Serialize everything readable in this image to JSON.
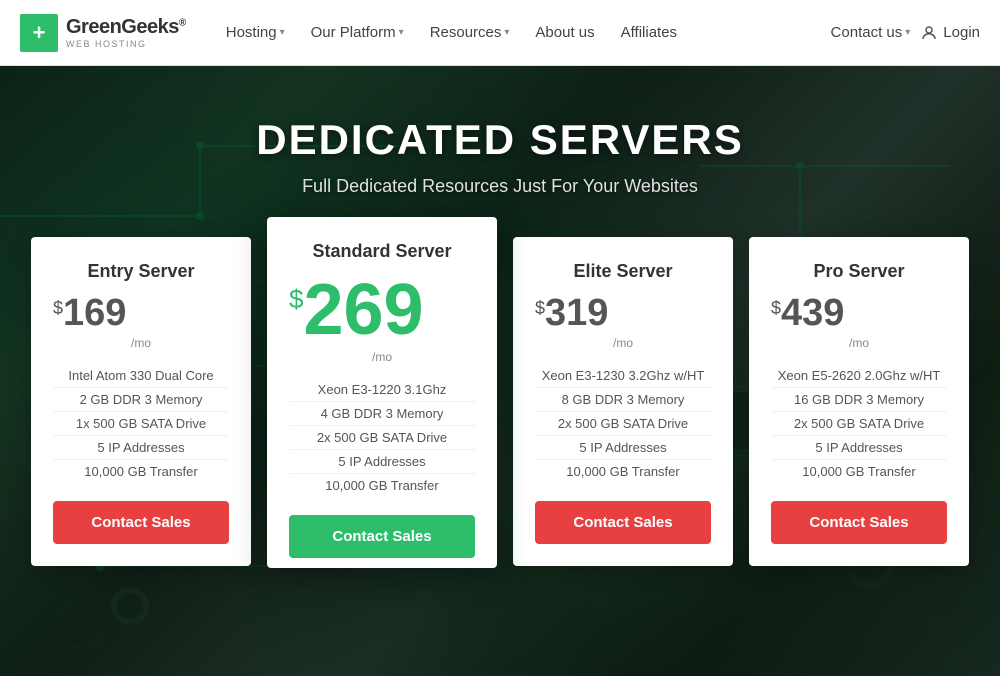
{
  "navbar": {
    "logo_name": "GreenGeeks",
    "logo_registered": "®",
    "logo_sub": "WEB HOSTING",
    "nav_items": [
      {
        "label": "Hosting",
        "has_arrow": true
      },
      {
        "label": "Our Platform",
        "has_arrow": true
      },
      {
        "label": "Resources",
        "has_arrow": true
      },
      {
        "label": "About us",
        "has_arrow": false
      },
      {
        "label": "Affiliates",
        "has_arrow": false
      }
    ],
    "contact_us": "Contact us",
    "login": "Login"
  },
  "hero": {
    "title": "DEDICATED SERVERS",
    "subtitle": "Full Dedicated Resources Just For Your Websites"
  },
  "plans": [
    {
      "id": "entry",
      "name": "Entry Server",
      "price": "169",
      "per_mo": "/mo",
      "featured": false,
      "features": [
        "Intel Atom 330 Dual Core",
        "2 GB DDR 3 Memory",
        "1x 500 GB SATA Drive",
        "5 IP Addresses",
        "10,000 GB Transfer"
      ],
      "btn_label": "Contact Sales"
    },
    {
      "id": "standard",
      "name": "Standard Server",
      "price": "269",
      "per_mo": "/mo",
      "featured": true,
      "features": [
        "Xeon E3-1220 3.1Ghz",
        "4 GB DDR 3 Memory",
        "2x 500 GB SATA Drive",
        "5 IP Addresses",
        "10,000 GB Transfer"
      ],
      "btn_label": "Contact Sales"
    },
    {
      "id": "elite",
      "name": "Elite Server",
      "price": "319",
      "per_mo": "/mo",
      "featured": false,
      "features": [
        "Xeon E3-1230 3.2Ghz w/HT",
        "8 GB DDR 3 Memory",
        "2x 500 GB SATA Drive",
        "5 IP Addresses",
        "10,000 GB Transfer"
      ],
      "btn_label": "Contact Sales"
    },
    {
      "id": "pro",
      "name": "Pro Server",
      "price": "439",
      "per_mo": "/mo",
      "featured": false,
      "features": [
        "Xeon E5-2620 2.0Ghz w/HT",
        "16 GB DDR 3 Memory",
        "2x 500 GB SATA Drive",
        "5 IP Addresses",
        "10,000 GB Transfer"
      ],
      "btn_label": "Contact Sales"
    }
  ],
  "colors": {
    "green": "#2ebd6b",
    "red": "#e84040",
    "text_dark": "#333333",
    "text_mid": "#555555",
    "text_light": "#888888"
  }
}
